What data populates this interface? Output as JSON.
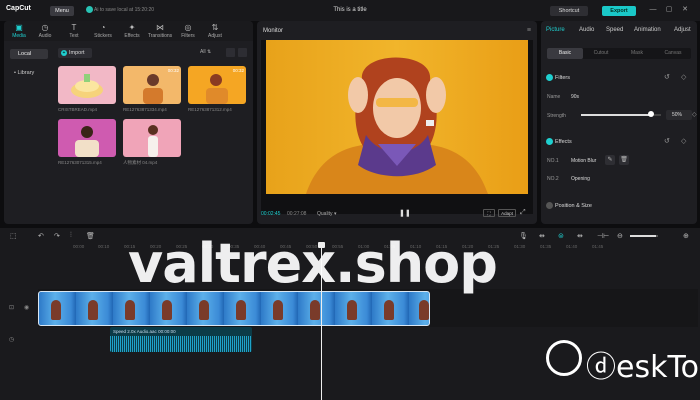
{
  "titlebar": {
    "app_name": "CapCut",
    "menu_label": "Menu",
    "autosave": "Ai to save local at 15:20:20",
    "window_title": "This is a title",
    "shortcut_label": "Shortcut",
    "export_label": "Export",
    "colors": {
      "accent": "#1fd0d0"
    }
  },
  "media": {
    "tools": [
      {
        "label": "Media",
        "icon": "media-icon"
      },
      {
        "label": "Audio",
        "icon": "audio-icon"
      },
      {
        "label": "Text",
        "icon": "text-icon"
      },
      {
        "label": "Stickers",
        "icon": "stickers-icon"
      },
      {
        "label": "Effects",
        "icon": "effects-icon"
      },
      {
        "label": "Transitions",
        "icon": "transitions-icon"
      },
      {
        "label": "Filters",
        "icon": "filters-icon"
      },
      {
        "label": "Adjust",
        "icon": "adjust-icon"
      }
    ],
    "side_local": "Local",
    "side_library": "Library",
    "import_label": "Import",
    "filter_all": "All",
    "thumbs": [
      {
        "label": "CRISTBREAD.mp4",
        "duration": "",
        "color": "#f2b8c6"
      },
      {
        "label": "RE12763871334.mp4",
        "duration": "00:32",
        "color": "#f3b86a"
      },
      {
        "label": "RE12763871312.mp4",
        "duration": "00:32",
        "color": "#f5a623"
      },
      {
        "label": "RE12763071315.mp4",
        "duration": "",
        "color": "#cf5bb0"
      },
      {
        "label": "人物素材 04.mp4",
        "duration": "",
        "color": "#f0a4b8"
      }
    ]
  },
  "monitor": {
    "title": "Monitor",
    "time_current": "00:02:45",
    "time_total": "00:27:08",
    "quality": "Quality",
    "ratio_label": "Adapt"
  },
  "props": {
    "tabs": [
      "Picture",
      "Audio",
      "Speed",
      "Animation",
      "Adjust"
    ],
    "subtabs": [
      "Basic",
      "Cutout",
      "Mask",
      "Canvas"
    ],
    "filters_title": "Filters",
    "name_label": "Name",
    "name_value": "90s",
    "strength_label": "Strength",
    "strength_value": "50%",
    "strength_level": 0.5,
    "effects_title": "Effects",
    "effect1_label": "NO.1",
    "effect1_value": "Motion Blur",
    "effect2_label": "NO.2",
    "effect2_value": "Opening",
    "position_title": "Position & Size"
  },
  "timeline": {
    "ticks": [
      "00:00",
      "00:10",
      "00:15",
      "00:20",
      "00:25",
      "00:30",
      "00:35",
      "00:40",
      "00:45",
      "00:50",
      "00:55",
      "01:00",
      "01:05",
      "01:10",
      "01:15",
      "01:20",
      "01:25",
      "01:30",
      "01:35",
      "01:40",
      "01:45"
    ],
    "audio_speed": "Speed 2.0x",
    "audio_name": "Audio.aac",
    "audio_time": "00:00:00"
  },
  "watermark": {
    "site": "valtrex.shop",
    "brand": "ⓓeskTop"
  }
}
